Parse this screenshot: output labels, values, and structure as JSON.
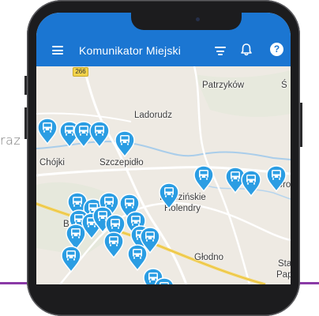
{
  "background_text": "raz",
  "app": {
    "title": "Komunikator Miejski",
    "help_glyph": "?"
  },
  "icons": {
    "menu": "menu-icon",
    "filter": "filter-icon",
    "notifications": "bell-icon",
    "help": "help-icon",
    "markers": "bus-stop-icon"
  },
  "colors": {
    "appbar": "#1b76d2",
    "marker": "#2b9de3",
    "accent_bar": "#8a3aa6"
  },
  "map": {
    "road_number": "266",
    "places": [
      "Patrzyków",
      "Ś",
      "Ladorudz",
      "Chójki",
      "Szczepidło",
      "Brzezińskie",
      "Holendry",
      "Borow",
      "B",
      "Głodno",
      "Sta",
      "Papro"
    ]
  }
}
